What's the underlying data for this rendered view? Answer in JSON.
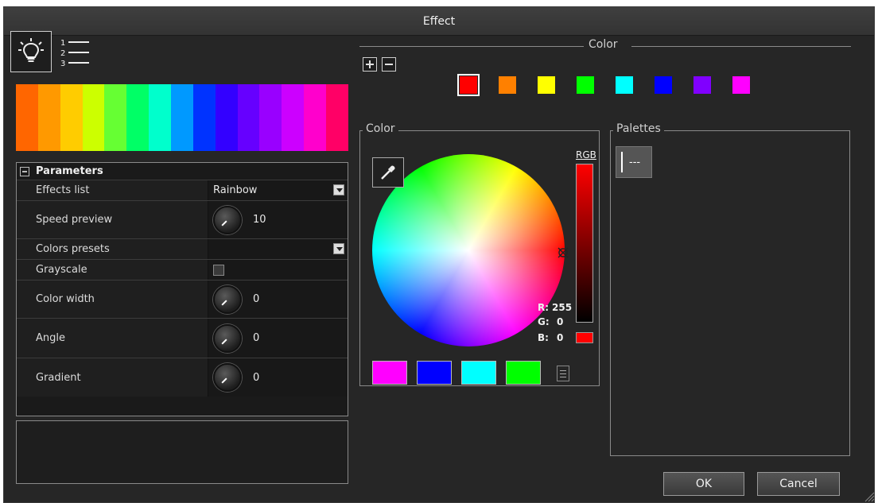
{
  "window": {
    "title": "Effect"
  },
  "toolbar": {
    "bulb_icon": "light-bulb-icon",
    "list_icon": "numbered-list-icon",
    "list_numbers": [
      "1",
      "2",
      "3"
    ]
  },
  "spectrum_colors": [
    "#ff6600",
    "#ff9900",
    "#ffcc00",
    "#ccff00",
    "#66ff33",
    "#00ff66",
    "#00ffcc",
    "#0099ff",
    "#0033ff",
    "#3300ff",
    "#6600ff",
    "#9900ff",
    "#cc00ff",
    "#ff00cc",
    "#ff0066"
  ],
  "params": {
    "header": "Parameters",
    "rows": [
      {
        "label": "Effects list",
        "value": "Rainbow",
        "kind": "dropdown"
      },
      {
        "label": "Speed preview",
        "value": "10",
        "kind": "knob"
      },
      {
        "label": "Colors presets",
        "value": "",
        "kind": "dropdown"
      },
      {
        "label": "Grayscale",
        "value": "",
        "kind": "checkbox"
      },
      {
        "label": "Color width",
        "value": "0",
        "kind": "knob"
      },
      {
        "label": "Angle",
        "value": "0",
        "kind": "knob"
      },
      {
        "label": "Gradient",
        "value": "0",
        "kind": "knob"
      }
    ]
  },
  "color_section": {
    "title": "Color",
    "swatches": [
      "#ff0000",
      "#ff8000",
      "#ffff00",
      "#00ff00",
      "#00ffff",
      "#0000ff",
      "#8000ff",
      "#ff00ff"
    ]
  },
  "color_box": {
    "title": "Color",
    "rgb_label": "RGB",
    "r_label": "R:",
    "r_value": "255",
    "g_label": "G:",
    "g_value": "0",
    "b_label": "B:",
    "b_value": "0",
    "current_color": "#ff0000",
    "bottom_swatches": [
      "#ff00ff",
      "#0000ff",
      "#00ffff",
      "#00ff00"
    ]
  },
  "palettes": {
    "title": "Palettes",
    "item": "---"
  },
  "buttons": {
    "ok": "OK",
    "cancel": "Cancel"
  }
}
